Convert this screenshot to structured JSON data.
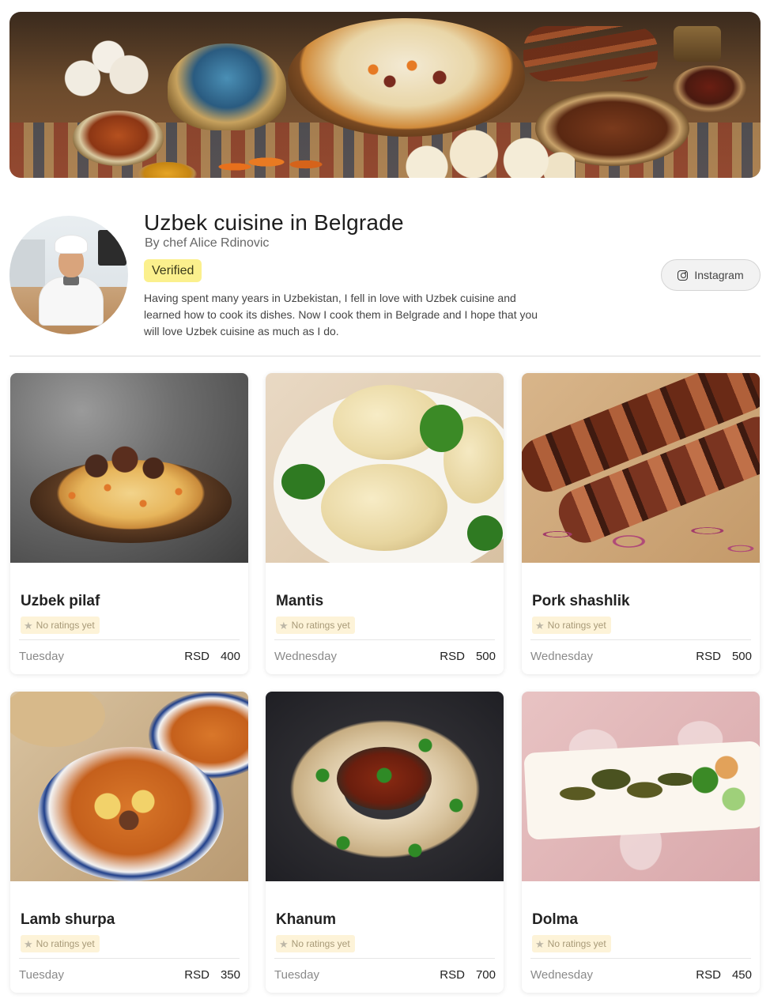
{
  "profile": {
    "title": "Uzbek cuisine in Belgrade",
    "chef": "By chef Alice Rdinovic",
    "badge": "Verified",
    "about": "Having spent many years in Uzbekistan, I fell in love with Uzbek cuisine and learned how to cook its dishes. Now I cook them in Belgrade and I hope that you will love Uzbek cuisine as much as I do.",
    "instagram_label": "Instagram"
  },
  "colors": {
    "badge": "#fbf08d",
    "rating_bg": "#fdf3d8",
    "divider": "#dcdcdc"
  },
  "icons": {
    "instagram": "instagram-icon",
    "star": "star-icon"
  },
  "dishes": [
    {
      "name": "Uzbek pilaf",
      "rating": "No ratings yet",
      "day": "Tuesday",
      "currency": "RSD",
      "price": "400"
    },
    {
      "name": "Mantis",
      "rating": "No ratings yet",
      "day": "Wednesday",
      "currency": "RSD",
      "price": "500"
    },
    {
      "name": "Pork shashlik",
      "rating": "No ratings yet",
      "day": "Wednesday",
      "currency": "RSD",
      "price": "500"
    },
    {
      "name": "Lamb shurpa",
      "rating": "No ratings yet",
      "day": "Tuesday",
      "currency": "RSD",
      "price": "350"
    },
    {
      "name": "Khanum",
      "rating": "No ratings yet",
      "day": "Tuesday",
      "currency": "RSD",
      "price": "700"
    },
    {
      "name": "Dolma",
      "rating": "No ratings yet",
      "day": "Wednesday",
      "currency": "RSD",
      "price": "450"
    }
  ]
}
